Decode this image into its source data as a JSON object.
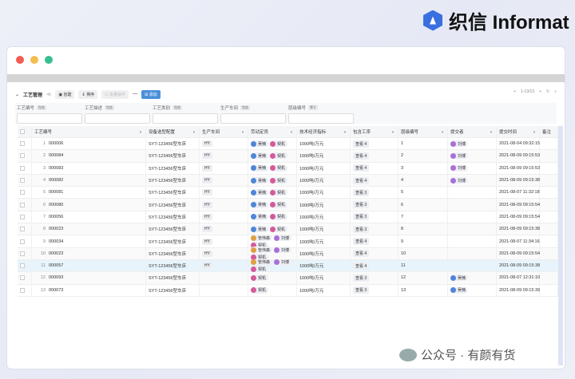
{
  "brand": {
    "logo_text": "织信 Informat",
    "color": "#3a6fe0"
  },
  "toolbar": {
    "title": "工艺管理",
    "create": "创建",
    "sort": "排序",
    "batch": "批量操作",
    "add": "添加",
    "pagination": "1-13/13"
  },
  "filters": [
    {
      "label": "工艺编号",
      "op": "包含"
    },
    {
      "label": "工艺描述",
      "op": "包含"
    },
    {
      "label": "工艺类别",
      "op": "包含"
    },
    {
      "label": "生产车间",
      "op": "包含"
    },
    {
      "label": "层级编号",
      "op": "等于"
    }
  ],
  "columns": [
    "工艺编号",
    "设备选型配置",
    "生产车间",
    "劳动定员",
    "技术经济指标",
    "包含工序",
    "层级编号",
    "提交者",
    "提交时间",
    "备注"
  ],
  "rows": [
    {
      "n": "1",
      "id": "000006",
      "eq": "SYT-123456型车床",
      "ws": "HY",
      "staff": [
        "吴楠",
        "契机"
      ],
      "idx": "1000吨/万元",
      "proc": "查看 4",
      "lvl": "1",
      "sub": "刘博",
      "time": "2021-08-04 09:32:15"
    },
    {
      "n": "2",
      "id": "000084",
      "eq": "SYT-123456型车床",
      "ws": "HY",
      "staff": [
        "吴楠",
        "契机"
      ],
      "idx": "1000吨/万元",
      "proc": "查看 4",
      "lvl": "2",
      "sub": "刘博",
      "time": "2021-08-09 09:15:53"
    },
    {
      "n": "3",
      "id": "000083",
      "eq": "SYT-123456型车床",
      "ws": "HY",
      "staff": [
        "吴楠",
        "契机"
      ],
      "idx": "1000吨/万元",
      "proc": "查看 4",
      "lvl": "3",
      "sub": "刘博",
      "time": "2021-08-09 09:15:53"
    },
    {
      "n": "4",
      "id": "000082",
      "eq": "SYT-123456型车床",
      "ws": "HY",
      "staff": [
        "吴楠",
        "契机"
      ],
      "idx": "1000吨/万元",
      "proc": "查看 4",
      "lvl": "4",
      "sub": "刘博",
      "time": "2021-08-09 09:15:38"
    },
    {
      "n": "5",
      "id": "000081",
      "eq": "SYT-123456型车床",
      "ws": "HY",
      "staff": [
        "吴楠",
        "契机"
      ],
      "idx": "1000吨/万元",
      "proc": "查看 3",
      "lvl": "5",
      "sub": "",
      "time": "2021-08-07 11:32:18"
    },
    {
      "n": "6",
      "id": "000080",
      "eq": "SYT-123456型车床",
      "ws": "HY",
      "staff": [
        "吴楠",
        "契机"
      ],
      "idx": "1000吨/万元",
      "proc": "查看 3",
      "lvl": "6",
      "sub": "",
      "time": "2021-08-09 09:15:54"
    },
    {
      "n": "7",
      "id": "000056",
      "eq": "SYT-123456型车床",
      "ws": "HY",
      "staff": [
        "吴楠",
        "契机"
      ],
      "idx": "1000吨/万元",
      "proc": "查看 3",
      "lvl": "7",
      "sub": "",
      "time": "2021-08-09 09:15:54"
    },
    {
      "n": "8",
      "id": "000023",
      "eq": "SYT-123456型车床",
      "ws": "HY",
      "staff": [
        "吴楠",
        "契机"
      ],
      "idx": "1000吨/万元",
      "proc": "查看 3",
      "lvl": "8",
      "sub": "",
      "time": "2021-08-09 09:15:38"
    },
    {
      "n": "9",
      "id": "000034",
      "eq": "SYT-123456型车床",
      "ws": "HY",
      "staff": [
        "管伟森",
        "刘博",
        "契机"
      ],
      "idx": "1000吨/万元",
      "proc": "查看 4",
      "lvl": "9",
      "sub": "",
      "time": "2021-08-07 11:34:16"
    },
    {
      "n": "10",
      "id": "000023",
      "eq": "SYT-123456型车床",
      "ws": "HY",
      "staff": [
        "管伟森",
        "刘博",
        "契机"
      ],
      "idx": "1000吨/万元",
      "proc": "查看 4",
      "lvl": "10",
      "sub": "",
      "time": "2021-08-09 09:15:54"
    },
    {
      "n": "11",
      "id": "000057",
      "eq": "SYT-123456型车床",
      "ws": "HY",
      "staff": [
        "管伟森",
        "刘博",
        "契机"
      ],
      "idx": "1000吨/万元",
      "proc": "查看 4",
      "lvl": "11",
      "sub": "",
      "time": "2021-08-09 09:15:38"
    },
    {
      "n": "12",
      "id": "000093",
      "eq": "SYT-123456型车床",
      "ws": "",
      "staff": [
        "契机"
      ],
      "idx": "1000吨/万元",
      "proc": "查看 3",
      "lvl": "12",
      "sub": "吴楠",
      "time": "2021-08-07 12:31:10"
    },
    {
      "n": "13",
      "id": "000073",
      "eq": "SYT-123456型车床",
      "ws": "",
      "staff": [
        "契机"
      ],
      "idx": "1000吨/万元",
      "proc": "查看 3",
      "lvl": "13",
      "sub": "吴楠",
      "time": "2021-08-09 09:15:39"
    }
  ],
  "selected_row": "11",
  "watermark": "公众号 · 有颜有货"
}
